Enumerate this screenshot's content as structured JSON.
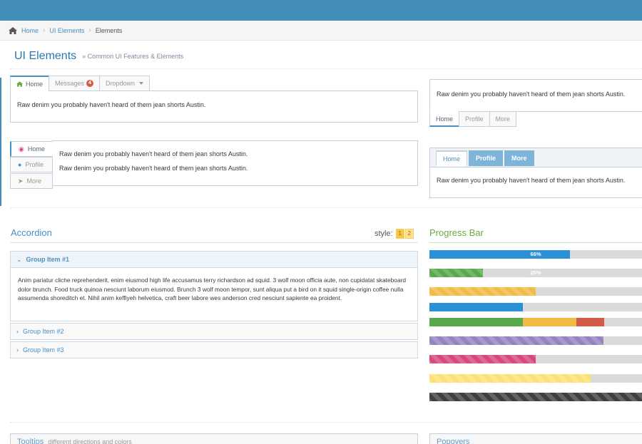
{
  "breadcrumb": {
    "items": [
      "Home",
      "UI Elements"
    ],
    "current": "Elements",
    "separator": "›"
  },
  "page": {
    "title": "UI Elements",
    "subtitle": "» Common UI Features & Elements"
  },
  "tabs1": {
    "home": "Home",
    "messages": "Messages",
    "messages_badge": "4",
    "dropdown": "Dropdown",
    "content": "Raw denim you probably haven't heard of them jean shorts Austin."
  },
  "tabs2": {
    "content": "Raw denim you probably haven't heard of them jean shorts Austin.",
    "home": "Home",
    "profile": "Profile",
    "more": "More"
  },
  "tabs3": {
    "home": "Home",
    "profile": "Profile",
    "more": "More",
    "line1": "Raw denim you probably haven't heard of them jean shorts Austin.",
    "line2": "Raw denim you probably haven't heard of them jean shorts Austin."
  },
  "tabs4": {
    "home": "Home",
    "profile": "Profile",
    "more": "More",
    "content": "Raw denim you probably haven't heard of them jean shorts Austin."
  },
  "accordion": {
    "title": "Accordion",
    "style_label": "style:",
    "style_options": [
      "1",
      "2"
    ],
    "items": [
      "Group Item #1",
      "Group Item #2",
      "Group Item #3"
    ],
    "body": "Anim pariatur cliche reprehenderit, enim eiusmod high life accusamus terry richardson ad squid. 3 wolf moon officia aute, non cupidatat skateboard dolor brunch. Food truck quinoa nesciunt laborum eiusmod. Brunch 3 wolf moon tempor, sunt aliqua put a bird on it squid single-origin coffee nulla assumenda shoreditch et. Nihil anim keffiyeh helvetica, craft beer labore wes anderson cred nesciunt sapiente ea proident."
  },
  "progress": {
    "title": "Progress Bar",
    "bars": [
      {
        "segments": [
          {
            "value": 0.66,
            "color": "#2a91d8"
          }
        ],
        "label": "66%",
        "striped": false
      },
      {
        "segments": [
          {
            "value": 0.25,
            "color": "#59a84b"
          }
        ],
        "label": "25%",
        "striped": true
      },
      {
        "segments": [
          {
            "value": 0.5,
            "color": "#f2bb46"
          }
        ],
        "label": "",
        "striped": true
      },
      {
        "segments": [
          {
            "value": 0.44,
            "color": "#2a91d8"
          }
        ],
        "label": "",
        "striped": false
      },
      {
        "segments": [
          {
            "value": 0.44,
            "color": "#59a84b"
          },
          {
            "value": 0.25,
            "color": "#f2bb46"
          },
          {
            "value": 0.13,
            "color": "#d15b47"
          }
        ],
        "label": "",
        "striped": false
      },
      {
        "segments": [
          {
            "value": 0.82,
            "color": "#9585bf"
          }
        ],
        "label": "",
        "striped": true
      },
      {
        "segments": [
          {
            "value": 0.5,
            "color": "#d6487e"
          }
        ],
        "label": "",
        "striped": true
      },
      {
        "segments": [
          {
            "value": 0.76,
            "color": "#fee074"
          }
        ],
        "label": "",
        "striped": true
      },
      {
        "segments": [
          {
            "value": 1.0,
            "color": "#404040"
          }
        ],
        "label": "",
        "striped": true
      }
    ]
  },
  "bottom": {
    "tooltips_title": "Tooltips",
    "tooltips_sub": "different directions and colors",
    "popovers_title": "Popovers"
  },
  "colors": {
    "header": "#438eb9",
    "link": "#4c8fbd",
    "progress_title": "#69aa46"
  }
}
